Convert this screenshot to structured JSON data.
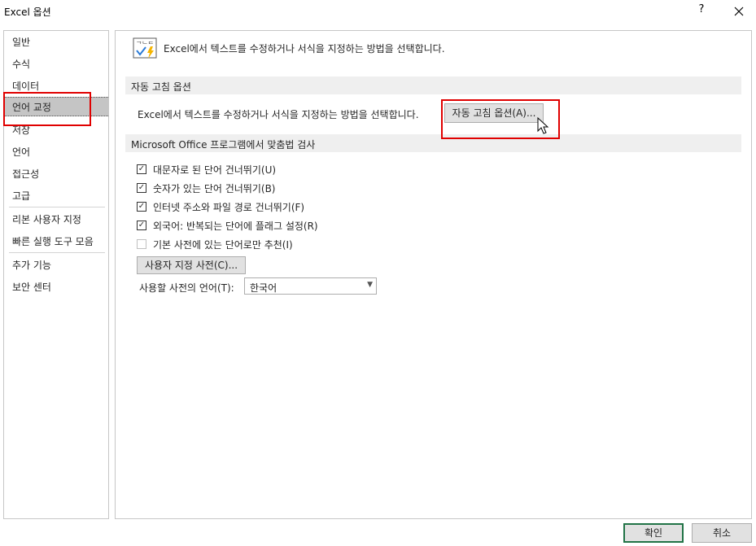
{
  "window": {
    "title": "Excel 옵션",
    "help_label": "?",
    "close_label": "✕"
  },
  "nav": {
    "items": [
      {
        "label": "일반",
        "name": "nav-item-general"
      },
      {
        "label": "수식",
        "name": "nav-item-formulas"
      },
      {
        "label": "데이터",
        "name": "nav-item-data"
      },
      {
        "label": "언어 교정",
        "name": "nav-item-proofing",
        "selected": true
      },
      {
        "label": "저장",
        "name": "nav-item-save"
      },
      {
        "label": "언어",
        "name": "nav-item-language"
      },
      {
        "label": "접근성",
        "name": "nav-item-accessibility"
      },
      {
        "label": "고급",
        "name": "nav-item-advanced"
      },
      {
        "label": "리본 사용자 지정",
        "name": "nav-item-customize-ribbon"
      },
      {
        "label": "빠른 실행 도구 모음",
        "name": "nav-item-quick-access"
      },
      {
        "label": "추가 기능",
        "name": "nav-item-addins"
      },
      {
        "label": "보안 센터",
        "name": "nav-item-trust-center"
      }
    ]
  },
  "content": {
    "header_text": "Excel에서 텍스트를 수정하거나 서식을 지정하는 방법을 선택합니다.",
    "header_icon": "abc-check-icon",
    "autocorrect_section": {
      "title": "자동 고침 옵션",
      "description": "Excel에서 텍스트를 수정하거나 서식을 지정하는 방법을 선택합니다.",
      "button_label": "자동 고침 옵션(A)..."
    },
    "spelling_section": {
      "title": "Microsoft Office 프로그램에서 맞춤법 검사",
      "checkboxes": [
        {
          "label": "대문자로 된 단어 건너뛰기(U)",
          "checked": true
        },
        {
          "label": "숫자가 있는 단어 건너뛰기(B)",
          "checked": true
        },
        {
          "label": "인터넷 주소와 파일 경로 건너뛰기(F)",
          "checked": true
        },
        {
          "label": "외국어: 반복되는 단어에 플래그 설정(R)",
          "checked": true
        },
        {
          "label": "기본 사전에 있는 단어로만 추천(I)",
          "checked": false
        }
      ],
      "custom_dict_button": "사용자 지정 사전(C)...",
      "dict_language_label": "사용할 사전의 언어(T):",
      "dict_language_value": "한국어"
    }
  },
  "footer": {
    "ok_label": "확인",
    "cancel_label": "취소"
  },
  "colors": {
    "highlight": "#e00000",
    "ok_border": "#217346",
    "section_bg": "#efefef",
    "selected_nav": "#c5c5c5"
  }
}
